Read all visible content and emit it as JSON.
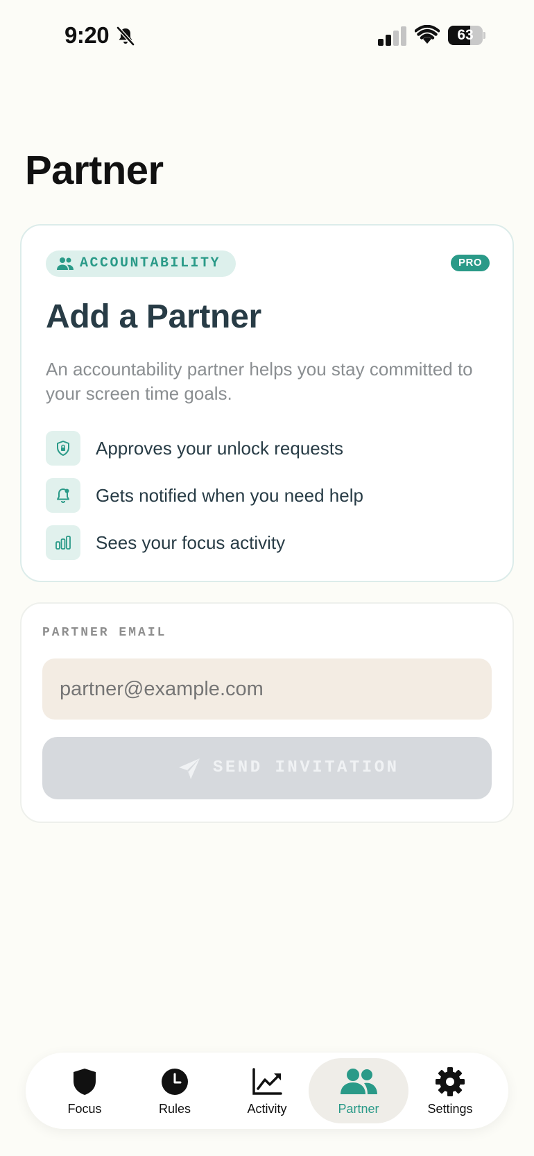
{
  "status_bar": {
    "time": "9:20",
    "battery_percent": "63",
    "battery_level": 0.63
  },
  "page": {
    "title": "Partner"
  },
  "accountability_card": {
    "badge_label": "ACCOUNTABILITY",
    "pro_label": "PRO",
    "heading": "Add a Partner",
    "description": "An accountability partner helps you stay committed to your screen time goals.",
    "features": [
      {
        "icon": "shield-lock-icon",
        "label": "Approves your unlock requests"
      },
      {
        "icon": "bell-icon",
        "label": "Gets notified when you need help"
      },
      {
        "icon": "bar-chart-icon",
        "label": "Sees your focus activity"
      }
    ]
  },
  "email_card": {
    "label": "PARTNER EMAIL",
    "placeholder": "partner@example.com",
    "value": "",
    "send_label": "SEND INVITATION"
  },
  "tab_bar": {
    "tabs": [
      {
        "label": "Focus",
        "icon": "shield-icon"
      },
      {
        "label": "Rules",
        "icon": "clock-icon"
      },
      {
        "label": "Activity",
        "icon": "chart-icon"
      },
      {
        "label": "Partner",
        "icon": "people-icon",
        "active": true
      },
      {
        "label": "Settings",
        "icon": "gear-icon"
      }
    ]
  },
  "colors": {
    "accent": "#2a9a88",
    "background": "#fcfcf7",
    "link": "#1e7be0"
  }
}
